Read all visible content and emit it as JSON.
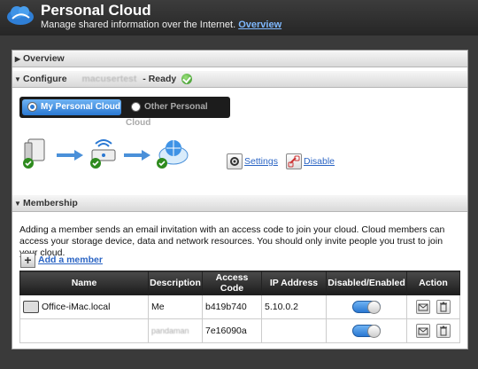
{
  "header": {
    "title": "Personal Cloud",
    "subtitle": "Manage shared information over the Internet.",
    "overview_link": "Overview"
  },
  "sections": {
    "overview": "Overview",
    "configure": "Configure",
    "configure_user": "macusertest",
    "configure_status": "- Ready",
    "membership": "Membership"
  },
  "cloud_toggle": {
    "my_label": "My Personal Cloud",
    "other_label": "Other Personal Cloud",
    "selected": "My Personal Cloud"
  },
  "actions": {
    "settings": "Settings",
    "disable": "Disable"
  },
  "membership": {
    "description": "Adding a member sends an email invitation with an access code to join your cloud. Cloud members can access your storage device, data and network resources. You should only invite people you trust to join your cloud.",
    "add_member": "Add a member",
    "columns": [
      "Name",
      "Description",
      "Access Code",
      "IP Address",
      "Disabled/Enabled",
      "Action"
    ],
    "rows": [
      {
        "name": "Office-iMac.local",
        "description": "Me",
        "access_code": "b419b740",
        "ip": "5.10.0.2",
        "enabled": true
      },
      {
        "name": "",
        "description": "pandaman",
        "access_code": "7e16090a",
        "ip": "",
        "enabled": true
      }
    ]
  },
  "colors": {
    "accent": "#2a78d2",
    "ok": "#2e8b1e",
    "link": "#2a64c4"
  }
}
